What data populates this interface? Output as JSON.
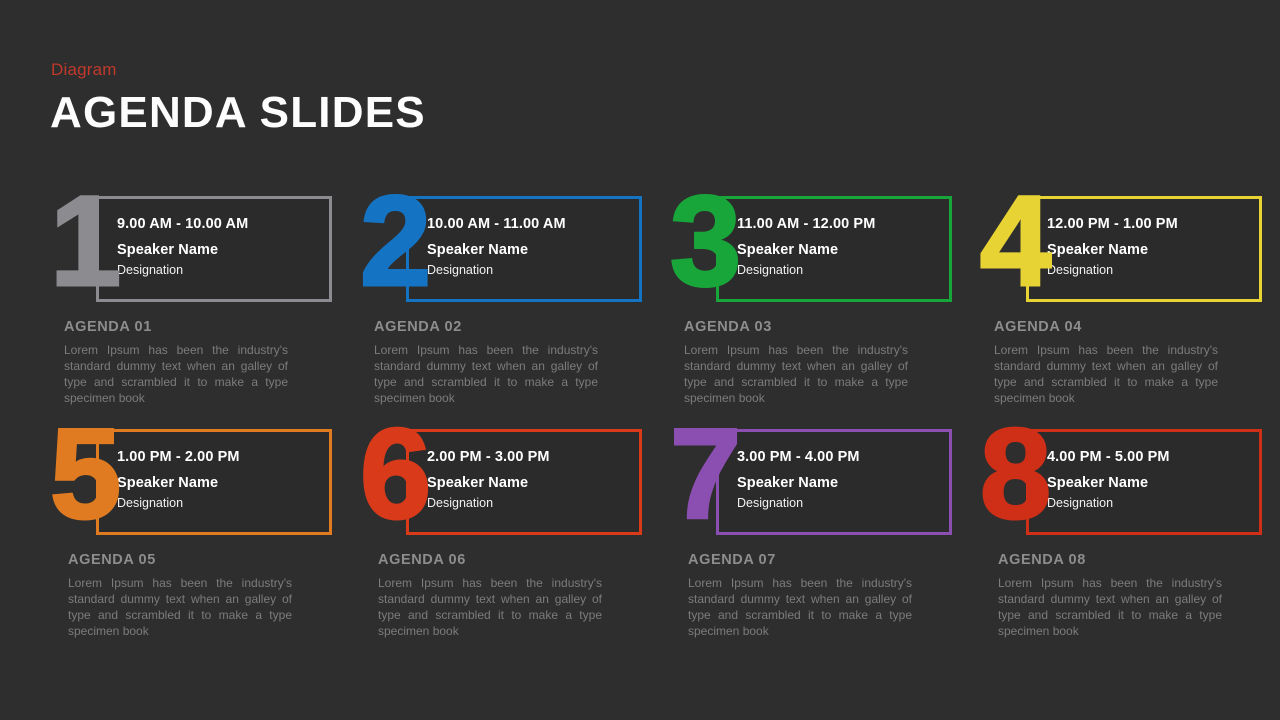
{
  "header": {
    "kicker": "Diagram",
    "title": "AGENDA SLIDES"
  },
  "colors": {
    "background": "#2e2e2e",
    "card_fill": "#2b2b2b",
    "kicker": "#c0392b",
    "title": "#fdfdfd",
    "agenda_label": "#8d8d8d",
    "agenda_body": "#7c7c7c"
  },
  "cards": [
    {
      "number": "1",
      "accent": "#8b8b90",
      "time": "9.00 AM - 10.00 AM",
      "speaker": "Speaker Name",
      "designation": "Designation",
      "label": "AGENDA 01",
      "body": "Lorem Ipsum has been the industry's standard dummy text when an galley of type and scrambled it to make a type specimen book"
    },
    {
      "number": "2",
      "accent": "#1573c4",
      "time": "10.00 AM - 11.00 AM",
      "speaker": "Speaker Name",
      "designation": "Designation",
      "label": "AGENDA 02",
      "body": "Lorem Ipsum has been the industry's standard dummy text when an galley of type and scrambled it to make a type specimen book"
    },
    {
      "number": "3",
      "accent": "#18a63a",
      "time": "11.00 AM - 12.00 PM",
      "speaker": "Speaker Name",
      "designation": "Designation",
      "label": "AGENDA 03",
      "body": "Lorem Ipsum has been the industry's standard dummy text when an galley of type and scrambled it to make a type specimen book"
    },
    {
      "number": "4",
      "accent": "#e8d334",
      "time": "12.00 PM - 1.00 PM",
      "speaker": "Speaker Name",
      "designation": "Designation",
      "label": "AGENDA 04",
      "body": "Lorem Ipsum has been the industry's standard dummy text when an galley of type and scrambled it to make a type specimen book"
    },
    {
      "number": "5",
      "accent": "#e07b21",
      "time": "1.00 PM - 2.00 PM",
      "speaker": "Speaker Name",
      "designation": "Designation",
      "label": "AGENDA 05",
      "body": "Lorem Ipsum has been the industry's standard dummy text when an galley of type and scrambled it to make a type specimen book"
    },
    {
      "number": "6",
      "accent": "#d93a1a",
      "time": "2.00 PM - 3.00 PM",
      "speaker": "Speaker Name",
      "designation": "Designation",
      "label": "AGENDA 06",
      "body": "Lorem Ipsum has been the industry's standard dummy text when an galley of type and scrambled it to make a type specimen book"
    },
    {
      "number": "7",
      "accent": "#8a4fb0",
      "time": "3.00 PM - 4.00 PM",
      "speaker": "Speaker Name",
      "designation": "Designation",
      "label": "AGENDA 07",
      "body": "Lorem Ipsum has been the industry's standard dummy text when an galley of type and scrambled it to make a type specimen book"
    },
    {
      "number": "8",
      "accent": "#cf2f16",
      "time": "4.00 PM - 5.00 PM",
      "speaker": "Speaker Name",
      "designation": "Designation",
      "label": "AGENDA 08",
      "body": "Lorem Ipsum has been the industry's standard dummy text when an galley of type and scrambled it to make a type specimen book"
    }
  ]
}
